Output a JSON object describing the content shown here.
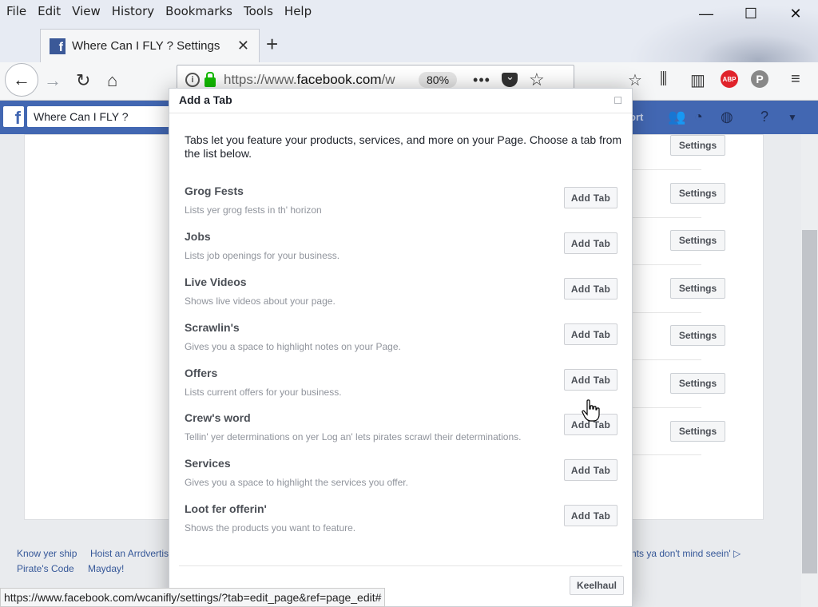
{
  "menu": [
    "File",
    "Edit",
    "View",
    "History",
    "Bookmarks",
    "Tools",
    "Help"
  ],
  "browser": {
    "tab_title": "Where Can I FLY ? Settings",
    "url_prefix": "https://www.",
    "url_host": "facebook.com",
    "url_rest": "/w",
    "zoom": "80%",
    "abp_label": "ABP"
  },
  "fb": {
    "search_value": "Where Can I FLY ?",
    "support_text": "ort"
  },
  "settings_button_label": "Settings",
  "modal": {
    "title": "Add a Tab",
    "intro": "Tabs let you feature your products, services, and more on your Page. Choose a tab from the list below.",
    "add_label": "Add Tab",
    "tabs": [
      {
        "name": "Grog Fests",
        "desc": "Lists yer grog fests in th' horizon"
      },
      {
        "name": "Jobs",
        "desc": "Lists job openings for your business."
      },
      {
        "name": "Live Videos",
        "desc": "Shows live videos about your page."
      },
      {
        "name": "Scrawlin's",
        "desc": "Gives you a space to highlight notes on your Page."
      },
      {
        "name": "Offers",
        "desc": "Lists current offers for your business."
      },
      {
        "name": "Crew's word",
        "desc": "Tellin' yer determinations on yer Log an' lets pirates scrawl their determinations."
      },
      {
        "name": "Services",
        "desc": "Gives you a space to highlight the services you offer."
      },
      {
        "name": "Loot fer offerin'",
        "desc": "Shows the products you want to feature."
      }
    ],
    "keelhaul_label": "Keelhaul"
  },
  "footer": {
    "link1": "Know yer ship",
    "link2": "Hoist an Arrdvertise",
    "link3": "Pirate's Code",
    "link4": "Mayday!",
    "right_text": "nts ya don't mind seein'"
  },
  "status_url": "https://www.facebook.com/wcanifly/settings/?tab=edit_page&ref=page_edit#"
}
